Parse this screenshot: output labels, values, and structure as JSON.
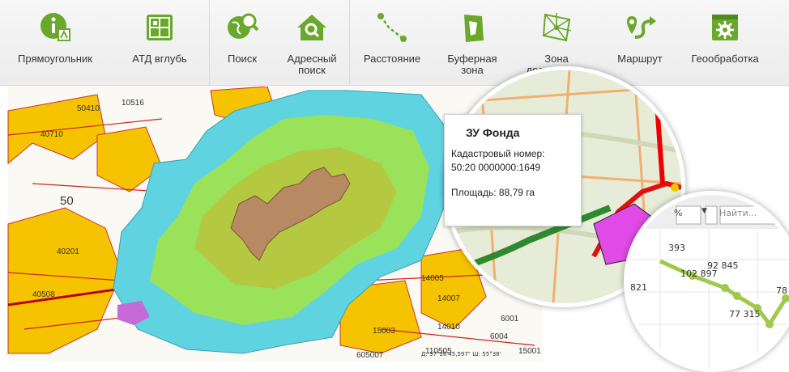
{
  "toolbar": {
    "buttons": [
      {
        "id": "rect",
        "label": "Прямоугольник",
        "icon": "info-flag-icon"
      },
      {
        "id": "atd",
        "label": "АТД вглубь",
        "icon": "map-grid-icon"
      },
      {
        "id": "search",
        "label": "Поиск",
        "icon": "globe-search-icon"
      },
      {
        "id": "address",
        "label": "Адресный\nпоиск",
        "icon": "house-search-icon"
      },
      {
        "id": "distance",
        "label": "Расстояние",
        "icon": "distance-icon"
      },
      {
        "id": "buffer",
        "label": "Буферная\nзона",
        "icon": "buffer-zone-icon"
      },
      {
        "id": "access",
        "label": "Зона\nдоступности",
        "icon": "accessibility-zone-icon"
      },
      {
        "id": "route",
        "label": "Маршрут",
        "icon": "route-icon"
      },
      {
        "id": "geo",
        "label": "Геообработка",
        "icon": "geoprocessing-icon"
      }
    ],
    "accent": "#6aa82c"
  },
  "map": {
    "labels": [
      {
        "text": "10516"
      },
      {
        "text": "50410"
      },
      {
        "text": "40710"
      },
      {
        "text": "50"
      },
      {
        "text": "40201"
      },
      {
        "text": "40508"
      },
      {
        "text": "14005"
      },
      {
        "text": "14007"
      },
      {
        "text": "14010"
      },
      {
        "text": "15003"
      },
      {
        "text": "6001"
      },
      {
        "text": "6004"
      },
      {
        "text": "110505"
      },
      {
        "text": "605007"
      },
      {
        "text": "15001"
      }
    ],
    "coords": "Д: 37°26'45,597\"  Ш: 55°38'",
    "colors": {
      "yellow": "#f6c300",
      "cyan": "#5fd3e0",
      "lime": "#9be25b",
      "olive": "#b5c842",
      "brown": "#b88a64"
    }
  },
  "popup": {
    "title": "ЗУ Фонда",
    "cadastral_label": "Кадастровый номер:",
    "cadastral_value": "50:20 0000000:1649",
    "area": "Площадь: 88,79 га"
  },
  "chart_lens": {
    "control_value": "%",
    "find_placeholder": "Найти...",
    "values": [
      "393",
      "92 845",
      "102 897",
      "821",
      "77 315",
      "78"
    ]
  }
}
